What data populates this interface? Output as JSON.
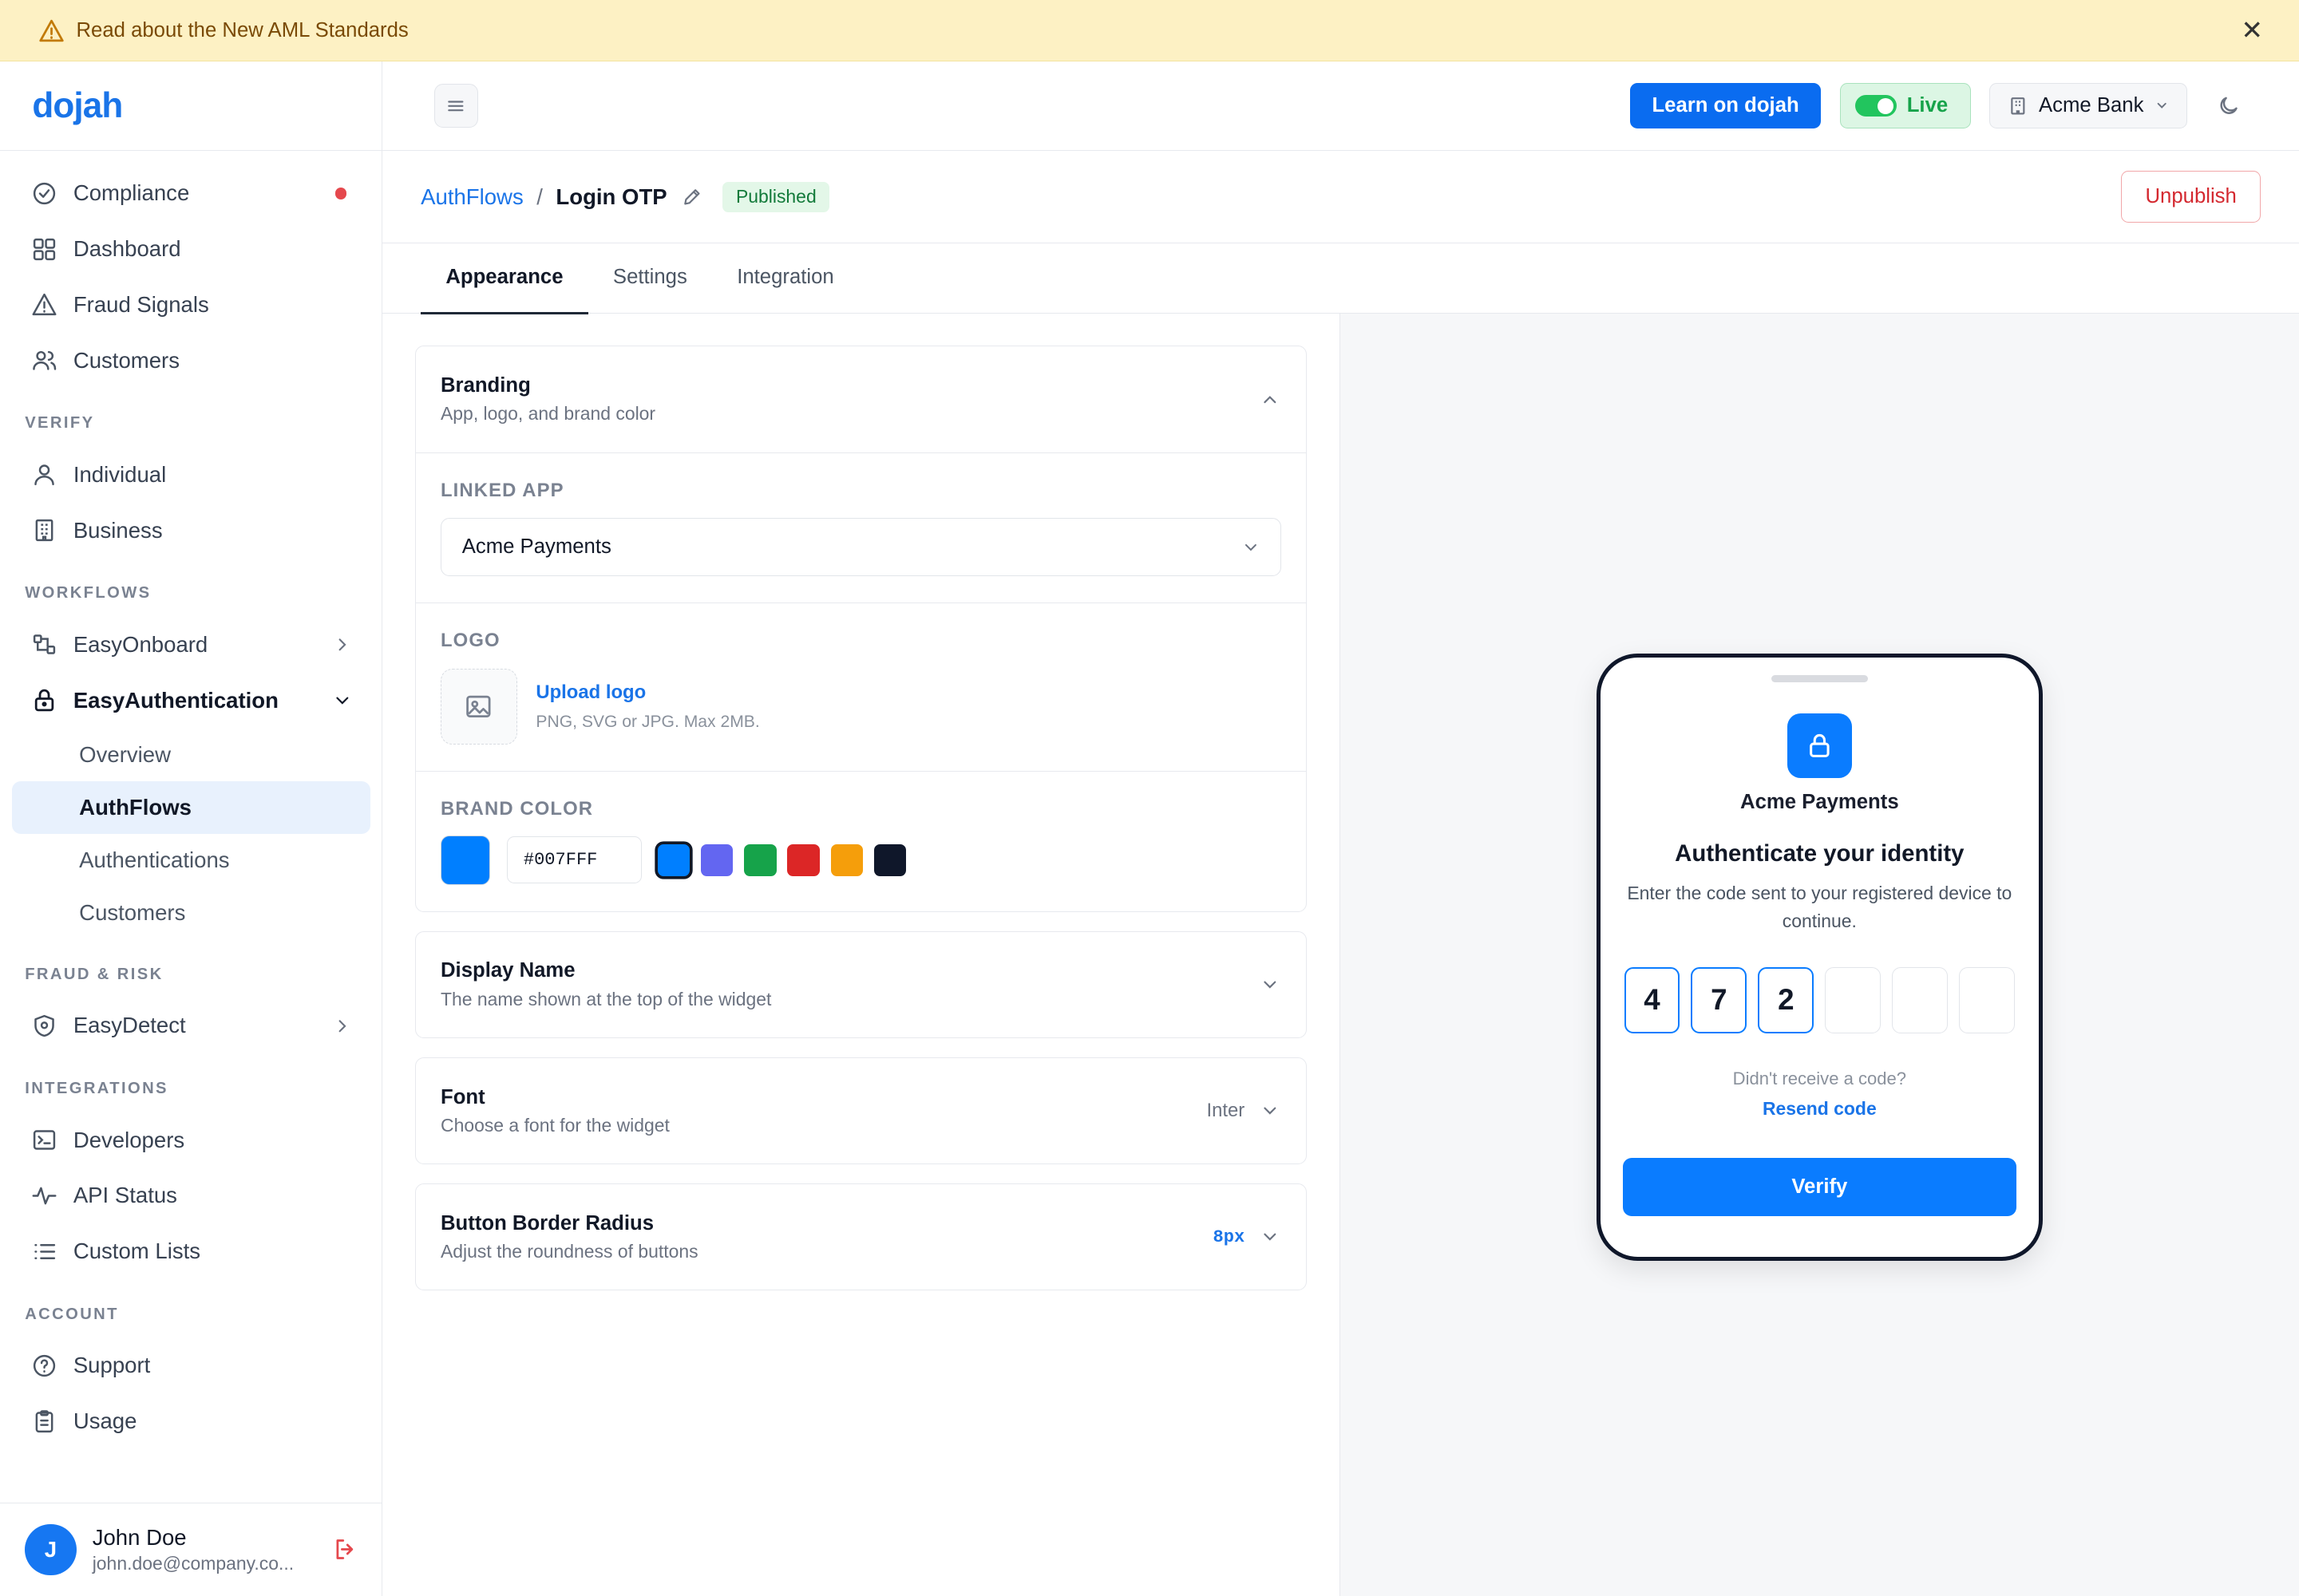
{
  "banner": {
    "text": "Read about the New AML Standards",
    "close": "✕"
  },
  "brand": {
    "logo": "dojah",
    "accent": "#0A6CF0"
  },
  "sidebar": {
    "top_items": [
      {
        "label": "Compliance",
        "icon": "check-circle-icon",
        "alert": true
      },
      {
        "label": "Dashboard",
        "icon": "grid-icon"
      },
      {
        "label": "Fraud Signals",
        "icon": "warning-icon"
      },
      {
        "label": "Customers",
        "icon": "users-icon"
      }
    ],
    "sections": {
      "verify": "VERIFY",
      "workflows": "WORKFLOWS",
      "fraud": "FRAUD & RISK",
      "integrations": "INTEGRATIONS",
      "account": "ACCOUNT"
    },
    "verify_items": [
      {
        "label": "Individual",
        "icon": "user-icon"
      },
      {
        "label": "Business",
        "icon": "building-icon"
      }
    ],
    "workflow_items": [
      {
        "label": "EasyOnboard",
        "icon": "flow-icon"
      },
      {
        "label": "EasyAuthentication",
        "icon": "lock-icon"
      }
    ],
    "auth_sub_items": [
      "Overview",
      "AuthFlows",
      "Authentications",
      "Customers"
    ],
    "fraud_items": [
      {
        "label": "EasyDetect",
        "icon": "shield-icon"
      }
    ],
    "integration_items": [
      {
        "label": "Developers",
        "icon": "terminal-icon"
      },
      {
        "label": "API Status",
        "icon": "pulse-icon"
      },
      {
        "label": "Custom Lists",
        "icon": "list-icon"
      }
    ],
    "account_items": [
      {
        "label": "Support",
        "icon": "help-icon"
      },
      {
        "label": "Usage",
        "icon": "clipboard-icon"
      }
    ],
    "user": {
      "initial": "J",
      "name": "John Doe",
      "email": "john.doe@company.co..."
    }
  },
  "topbar": {
    "learn": "Learn on dojah",
    "live": "Live",
    "org": "Acme Bank"
  },
  "breadcrumb": {
    "parent": "AuthFlows",
    "sep": "/",
    "current": "Login OTP",
    "status": "Published",
    "unpublish": "Unpublish"
  },
  "tabs": [
    "Appearance",
    "Settings",
    "Integration"
  ],
  "branding": {
    "title": "Branding",
    "subtitle": "App, logo, and brand color",
    "linked_app_label": "LINKED APP",
    "linked_app_value": "Acme Payments",
    "logo_label": "LOGO",
    "upload_label": "Upload logo",
    "upload_hint": "PNG, SVG or JPG. Max 2MB.",
    "color_label": "BRAND COLOR",
    "color_hex": "#007FFF",
    "presets": [
      "#007FFF",
      "#6366F1",
      "#16A34A",
      "#DC2626",
      "#F59E0B",
      "#0F172A"
    ]
  },
  "display_name": {
    "title": "Display Name",
    "subtitle": "The name shown at the top of the widget"
  },
  "font": {
    "title": "Font",
    "subtitle": "Choose a font for the widget",
    "value": "Inter"
  },
  "radius": {
    "title": "Button Border Radius",
    "subtitle": "Adjust the roundness of buttons",
    "value": "8px"
  },
  "preview": {
    "app_name": "Acme Payments",
    "title": "Authenticate your identity",
    "subtitle": "Enter the code sent to your registered device to continue.",
    "otp": [
      "4",
      "7",
      "2",
      "",
      "",
      ""
    ],
    "no_code": "Didn't receive a code?",
    "resend": "Resend code",
    "verify": "Verify"
  }
}
